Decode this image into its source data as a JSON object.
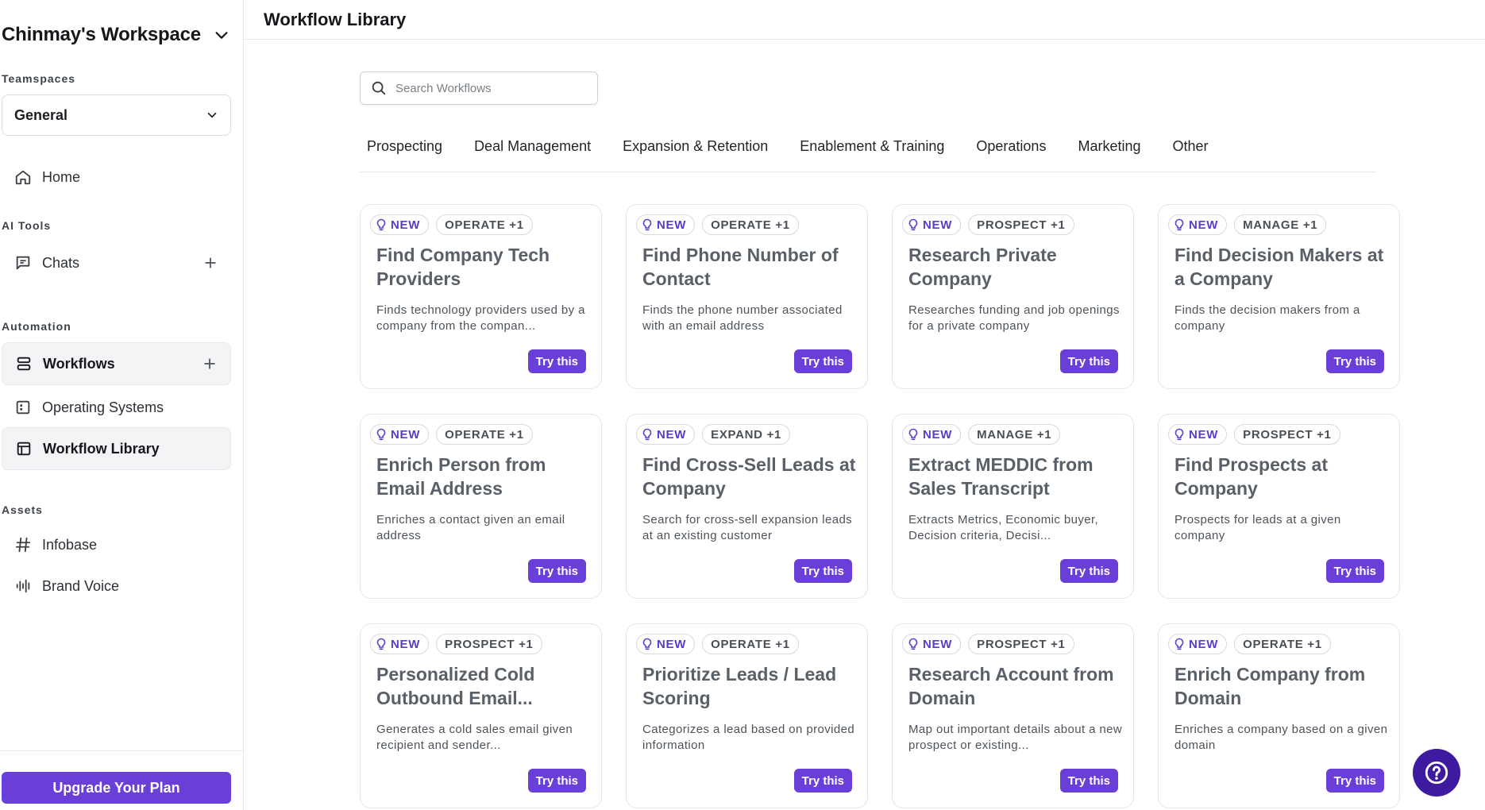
{
  "sidebar": {
    "workspace_name": "Chinmay's Workspace",
    "teamspaces_label": "Teamspaces",
    "teamspace_selected": "General",
    "home_label": "Home",
    "ai_tools_label": "AI Tools",
    "chats_label": "Chats",
    "automation_label": "Automation",
    "workflows_label": "Workflows",
    "operating_systems_label": "Operating Systems",
    "workflow_library_label": "Workflow Library",
    "assets_label": "Assets",
    "infobase_label": "Infobase",
    "brand_voice_label": "Brand Voice",
    "upgrade_label": "Upgrade Your Plan"
  },
  "header": {
    "title": "Workflow Library"
  },
  "search": {
    "placeholder": "Search Workflows"
  },
  "tabs": [
    "Prospecting",
    "Deal Management",
    "Expansion & Retention",
    "Enablement & Training",
    "Operations",
    "Marketing",
    "Other"
  ],
  "cards": [
    {
      "new": "NEW",
      "category": "OPERATE +1",
      "title": "Find Company Tech Providers",
      "desc": "Finds technology providers used by a company from the compan...",
      "cta": "Try this"
    },
    {
      "new": "NEW",
      "category": "OPERATE +1",
      "title": "Find Phone Number of Contact",
      "desc": "Finds the phone number associated with an email address",
      "cta": "Try this"
    },
    {
      "new": "NEW",
      "category": "PROSPECT +1",
      "title": "Research Private Company",
      "desc": "Researches funding and job openings for a private company",
      "cta": "Try this"
    },
    {
      "new": "NEW",
      "category": "MANAGE +1",
      "title": "Find Decision Makers at a Company",
      "desc": "Finds the decision makers from a company",
      "cta": "Try this"
    },
    {
      "new": "NEW",
      "category": "OPERATE +1",
      "title": "Enrich Person from Email Address",
      "desc": "Enriches a contact given an email address",
      "cta": "Try this"
    },
    {
      "new": "NEW",
      "category": "EXPAND +1",
      "title": "Find Cross-Sell Leads at Company",
      "desc": "Search for cross-sell expansion leads at an existing customer",
      "cta": "Try this"
    },
    {
      "new": "NEW",
      "category": "MANAGE +1",
      "title": "Extract MEDDIC from Sales Transcript",
      "desc": "Extracts Metrics, Economic buyer, Decision criteria, Decisi...",
      "cta": "Try this"
    },
    {
      "new": "NEW",
      "category": "PROSPECT +1",
      "title": "Find Prospects at Company",
      "desc": "Prospects for leads at a given company",
      "cta": "Try this"
    },
    {
      "new": "NEW",
      "category": "PROSPECT +1",
      "title": "Personalized Cold Outbound Email...",
      "desc": "Generates a cold sales email given recipient and sender...",
      "cta": "Try this"
    },
    {
      "new": "NEW",
      "category": "OPERATE +1",
      "title": "Prioritize Leads / Lead Scoring",
      "desc": "Categorizes a lead based on provided information",
      "cta": "Try this"
    },
    {
      "new": "NEW",
      "category": "PROSPECT +1",
      "title": "Research Account from Domain",
      "desc": "Map out important details about a new prospect or existing...",
      "cta": "Try this"
    },
    {
      "new": "NEW",
      "category": "OPERATE +1",
      "title": "Enrich Company from Domain",
      "desc": "Enriches a company based on a given domain",
      "cta": "Try this"
    }
  ],
  "colors": {
    "accent": "#6a3fd8",
    "help_button": "#3e1aa0"
  }
}
